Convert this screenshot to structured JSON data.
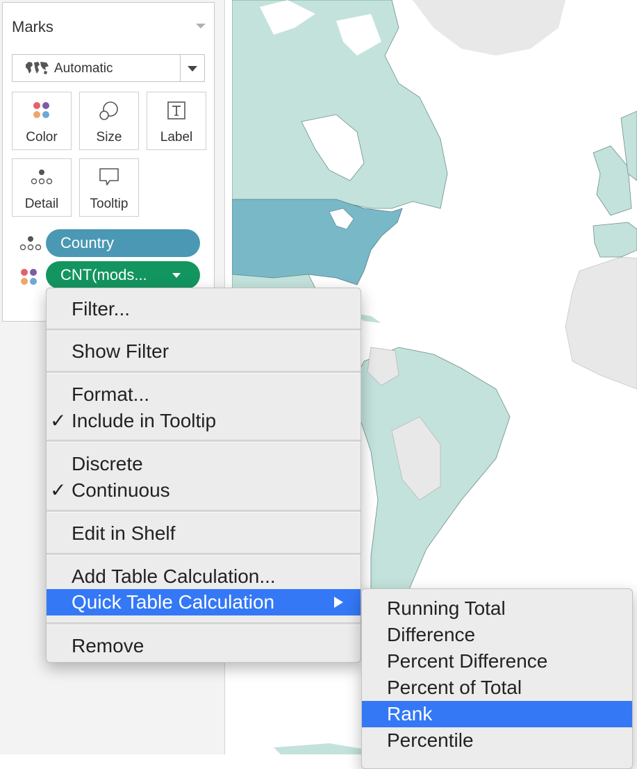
{
  "marks_card": {
    "title": "Marks",
    "mark_type": "Automatic",
    "buttons": {
      "color": "Color",
      "size": "Size",
      "label": "Label",
      "detail": "Detail",
      "tooltip": "Tooltip"
    },
    "fields": [
      {
        "name": "Country",
        "color": "#4a98b4",
        "encoding": "detail"
      },
      {
        "name": "CNT(mods...",
        "color": "#139560",
        "encoding": "color"
      }
    ]
  },
  "context_menu": {
    "items": {
      "filter": "Filter...",
      "show_filter": "Show Filter",
      "format": "Format...",
      "include_tooltip": "Include in Tooltip",
      "discrete": "Discrete",
      "continuous": "Continuous",
      "edit_in_shelf": "Edit in Shelf",
      "add_table_calc": "Add Table Calculation...",
      "quick_table_calc": "Quick Table Calculation",
      "remove": "Remove"
    },
    "checkmark": "✓",
    "checked": [
      "include_tooltip",
      "continuous"
    ],
    "highlighted": "quick_table_calc"
  },
  "submenu": {
    "items": [
      "Running Total",
      "Difference",
      "Percent Difference",
      "Percent of Total",
      "Rank",
      "Percentile"
    ],
    "highlighted": "Rank"
  },
  "colors": {
    "highlight": "#3478f6",
    "map_land_data": "#c3e2dc",
    "map_land_highlight": "#79b8c7",
    "map_land_nodata": "#e8e8e8"
  }
}
